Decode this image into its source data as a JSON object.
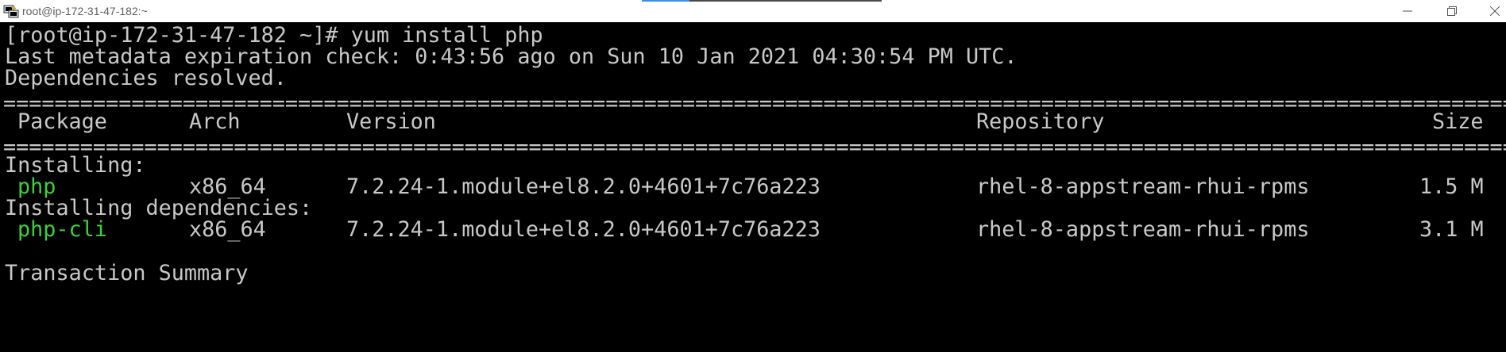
{
  "window": {
    "title": "root@ip-172-31-47-182:~"
  },
  "terminal": {
    "prompt": "[root@ip-172-31-47-182 ~]# yum install php",
    "metadata": "Last metadata expiration check: 0:43:56 ago on Sun 10 Jan 2021 04:30:54 PM UTC.",
    "deps_resolved": "Dependencies resolved.",
    "separator": "==================================================================================================================================================",
    "headers": {
      "package": "Package",
      "arch": "Arch",
      "version": "Version",
      "repository": "Repository",
      "size": "Size"
    },
    "installing_label": "Installing:",
    "installing_deps_label": "Installing dependencies:",
    "packages": [
      {
        "name": "php",
        "arch": "x86_64",
        "version": "7.2.24-1.module+el8.2.0+4601+7c76a223",
        "repository": "rhel-8-appstream-rhui-rpms",
        "size": "1.5 M"
      },
      {
        "name": "php-cli",
        "arch": "x86_64",
        "version": "7.2.24-1.module+el8.2.0+4601+7c76a223",
        "repository": "rhel-8-appstream-rhui-rpms",
        "size": "3.1 M"
      }
    ],
    "transaction_summary": "Transaction Summary"
  },
  "colors": {
    "background": "#000000",
    "text": "#c8c8c8",
    "package_name": "#3bd13b"
  },
  "icons": {
    "app": "putty-icon",
    "minimize": "minimize-icon",
    "maximize": "restore-icon",
    "close": "close-icon"
  }
}
